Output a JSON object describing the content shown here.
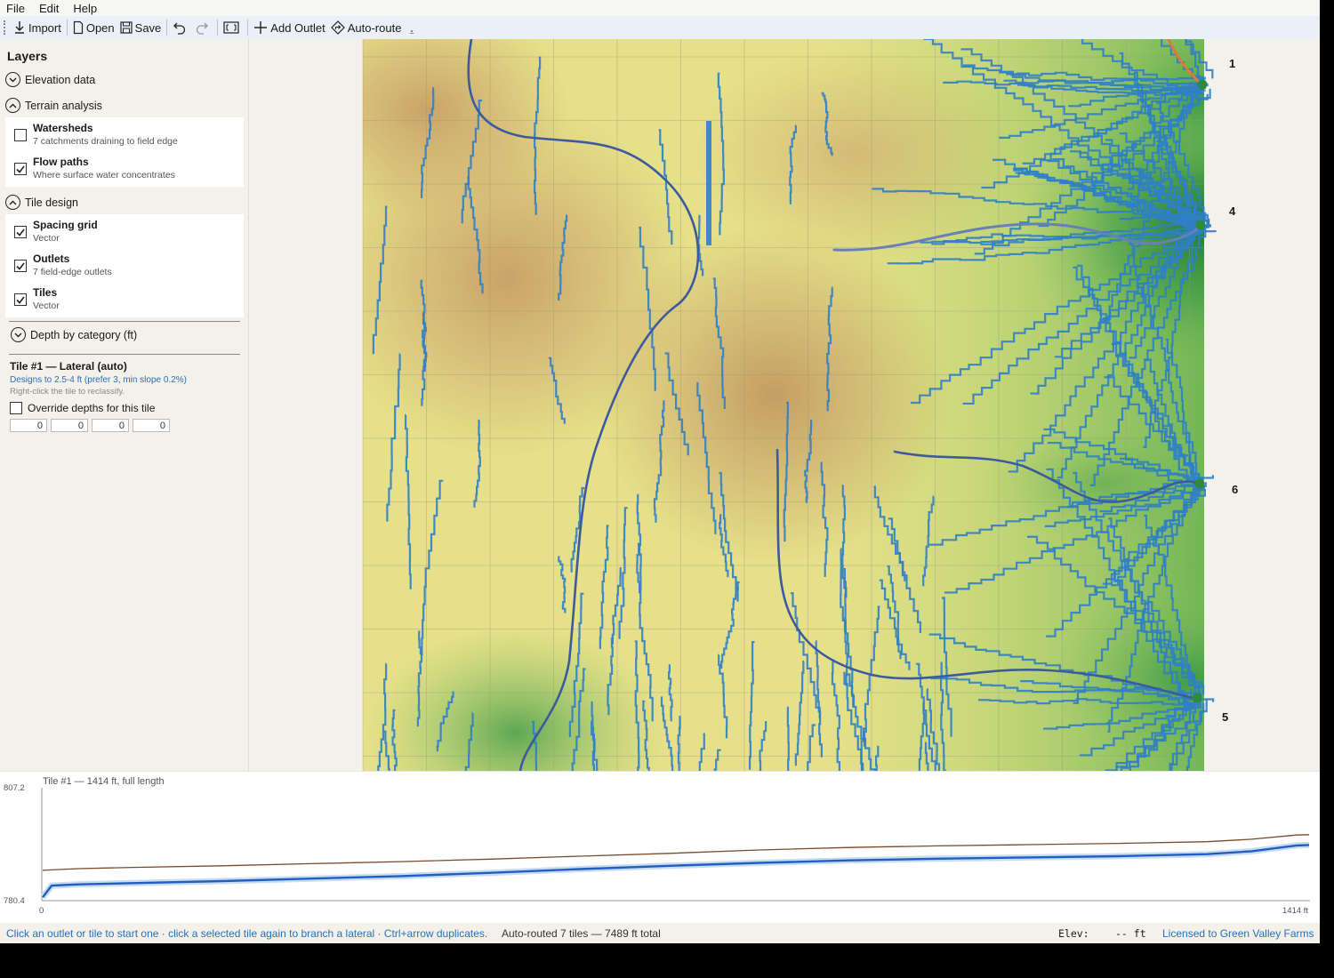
{
  "menu": {
    "items": [
      "File",
      "Edit",
      "Help"
    ]
  },
  "toolbar": {
    "import": "Import",
    "open": "Open",
    "save": "Save",
    "add_outlet": "Add Outlet",
    "auto_route": "Auto-route"
  },
  "sidebar": {
    "title": "Layers",
    "groups": {
      "elevation": {
        "label": "Elevation data",
        "expanded": false
      },
      "terrain": {
        "label": "Terrain analysis",
        "expanded": true,
        "items": [
          {
            "name": "Watersheds",
            "sub": "7 catchments draining to field edge",
            "checked": false
          },
          {
            "name": "Flow paths",
            "sub": "Where surface water concentrates",
            "checked": true
          }
        ]
      },
      "tile": {
        "label": "Tile design",
        "expanded": true,
        "items": [
          {
            "name": "Spacing grid",
            "sub": "Vector",
            "checked": true
          },
          {
            "name": "Outlets",
            "sub": "7 field-edge outlets",
            "checked": true
          },
          {
            "name": "Tiles",
            "sub": "Vector",
            "checked": true
          }
        ]
      },
      "depth": {
        "label": "Depth by category (ft)",
        "expanded": false
      }
    },
    "selected_tile": {
      "title": "Tile #1 — Lateral (auto)",
      "design": "Designs to 2.5-4 ft (prefer 3, min slope 0.2%)",
      "hint": "Right-click the tile to reclassify.",
      "override_label": "Override depths for this tile",
      "override_checked": false,
      "depths": [
        "0",
        "0",
        "0",
        "0"
      ]
    }
  },
  "map": {
    "outlets": [
      {
        "label": "1"
      },
      {
        "label": "4"
      },
      {
        "label": "6"
      },
      {
        "label": "5"
      }
    ],
    "colors": {
      "tile_line": "#3d5a9e",
      "flow_path": "#2f7fc7",
      "outlet": "#2e8b3d",
      "selected_tile": "#e07a30"
    }
  },
  "profile": {
    "title": "Tile #1 — 1414 ft, full length",
    "y_max": "807.2",
    "y_min": "780.4",
    "x_min": "0",
    "x_max": "1414 ft",
    "chart_data": {
      "type": "line",
      "x": [
        0,
        10,
        40,
        100,
        200,
        300,
        400,
        500,
        600,
        700,
        800,
        900,
        1000,
        1100,
        1200,
        1300,
        1350,
        1400,
        1414
      ],
      "series": [
        {
          "values": [
            787.5,
            787.6,
            787.9,
            788.2,
            788.6,
            789.1,
            789.6,
            790.2,
            790.9,
            791.6,
            792.4,
            793.0,
            793.4,
            793.7,
            794.0,
            794.4,
            795.0,
            796.0,
            796.1
          ]
        },
        {
          "values": [
            781.0,
            783.8,
            784.1,
            784.4,
            784.9,
            785.5,
            786.1,
            786.9,
            787.8,
            788.6,
            789.3,
            789.9,
            790.3,
            790.6,
            790.9,
            791.4,
            792.1,
            793.5,
            793.6
          ]
        }
      ],
      "ylim": [
        780.4,
        807.2
      ],
      "xlim": [
        0,
        1414
      ],
      "colors": [
        "#7a4a2a",
        "#1f5fbf"
      ]
    }
  },
  "status": {
    "hint": "Click an outlet or tile to start one · click a selected tile again to branch a lateral · Ctrl+arrow duplicates.",
    "autoroute": "Auto-routed 7 tiles — 7489 ft total",
    "elev_label": "Elev:",
    "elev_value": "-- ft",
    "license": "Licensed to Green Valley Farms"
  }
}
